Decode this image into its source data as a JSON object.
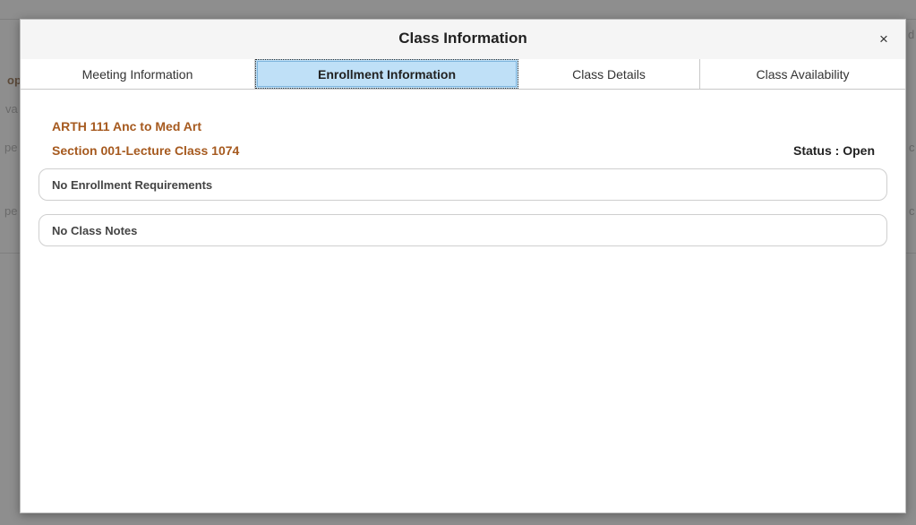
{
  "modal": {
    "title": "Class Information",
    "close_glyph": "×"
  },
  "tabs": [
    {
      "label": "Meeting Information",
      "active": false
    },
    {
      "label": "Enrollment Information",
      "active": true
    },
    {
      "label": "Class Details",
      "active": false
    },
    {
      "label": "Class Availability",
      "active": false
    }
  ],
  "class": {
    "title": "ARTH 111 Anc to Med Art",
    "section": "Section 001-Lecture Class 1074",
    "status": "Status : Open"
  },
  "enrollment_requirements": {
    "text": "No Enrollment Requirements"
  },
  "class_notes": {
    "text": "No Class Notes"
  },
  "background_fragments": {
    "frag1": "op",
    "frag2": "va",
    "frag3": "pe",
    "frag4": "pe",
    "frag5": "d",
    "frag6": "c",
    "frag7": "c"
  },
  "colors": {
    "accent_brown": "#a65a1f",
    "active_tab_bg": "#bfe0f7",
    "overlay_bg": "#8f8f8f"
  }
}
